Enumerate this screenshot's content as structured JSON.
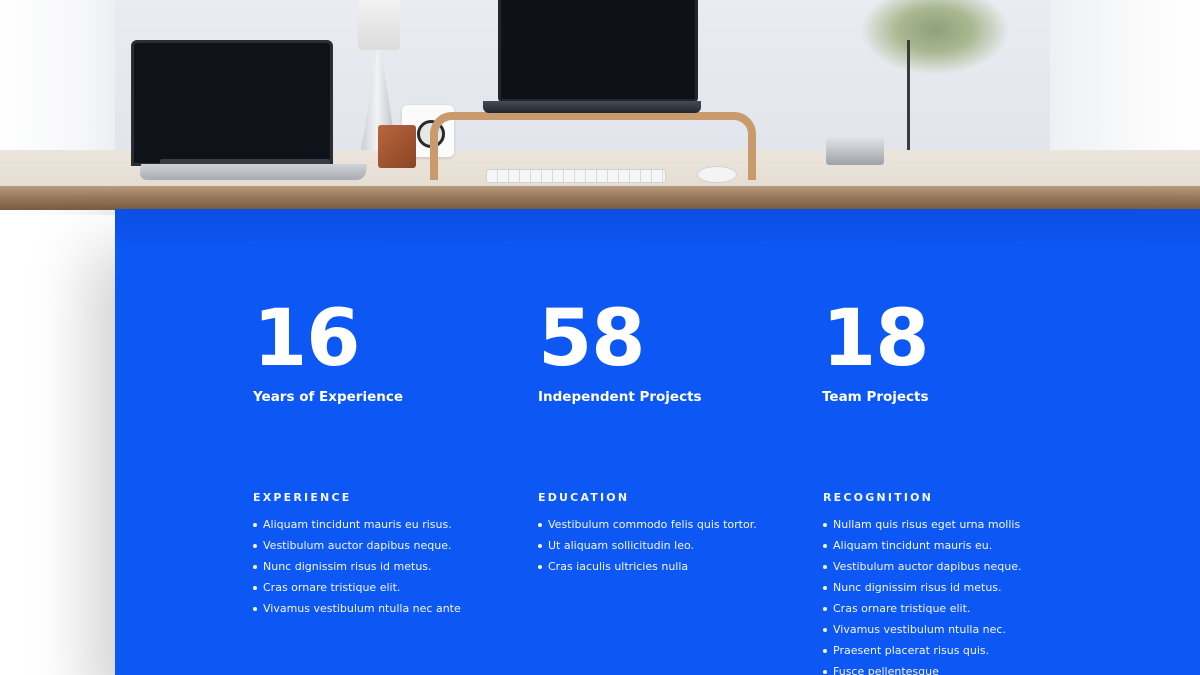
{
  "colors": {
    "panel_blue": "#0d57f4",
    "text": "#ffffff",
    "background": "#ffffff"
  },
  "hero_image": {
    "description_icons": [
      "laptop-icon",
      "lamp-icon",
      "speaker-icon",
      "plant-icon",
      "keyboard-icon",
      "mouse-icon"
    ]
  },
  "stats": [
    {
      "number": "16",
      "label": "Years of Experience"
    },
    {
      "number": "58",
      "label": "Independent Projects"
    },
    {
      "number": "18",
      "label": "Team Projects"
    }
  ],
  "columns": [
    {
      "heading": "EXPERIENCE",
      "items": [
        "Aliquam tincidunt mauris eu risus.",
        "Vestibulum auctor dapibus neque.",
        "Nunc dignissim risus id metus.",
        "Cras ornare tristique elit.",
        "Vivamus vestibulum ntulla nec ante"
      ]
    },
    {
      "heading": "EDUCATION",
      "items": [
        "Vestibulum commodo felis quis tortor.",
        "Ut aliquam sollicitudin leo.",
        "Cras iaculis ultricies nulla"
      ]
    },
    {
      "heading": "RECOGNITION",
      "items": [
        "Nullam quis risus eget urna mollis",
        "Aliquam tincidunt mauris eu.",
        "Vestibulum auctor dapibus neque.",
        "Nunc dignissim risus id metus.",
        "Cras ornare tristique elit.",
        "Vivamus vestibulum ntulla nec.",
        "Praesent placerat risus quis.",
        "Fusce pellentesque"
      ]
    }
  ]
}
